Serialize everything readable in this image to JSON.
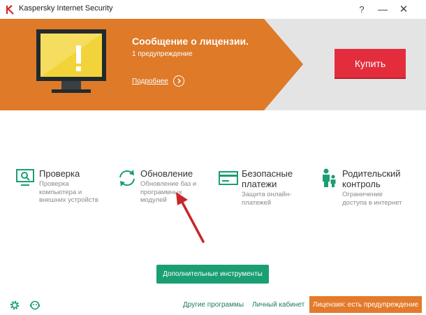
{
  "window": {
    "title": "Kaspersky Internet Security",
    "help_label": "?",
    "minimize_label": "—",
    "close_label": "✕"
  },
  "banner": {
    "title": "Сообщение о лицензии.",
    "subtitle": "1 предупреждение",
    "details_link": "Подробнее",
    "buy_label": "Купить",
    "colors": {
      "orange": "#de7a28",
      "gray": "#e4e4e4",
      "buy": "#e32d3d"
    }
  },
  "tiles": [
    {
      "icon": "scan-monitor-icon",
      "title_lines": [
        "Проверка"
      ],
      "desc_lines": [
        "Проверка",
        "компьютера и",
        "внешних устройств"
      ]
    },
    {
      "icon": "update-arrows-icon",
      "title_lines": [
        "Обновление"
      ],
      "desc_lines": [
        "Обновление баз и",
        "программных",
        "модулей"
      ]
    },
    {
      "icon": "credit-card-icon",
      "title_lines": [
        "Безопасные",
        "платежи"
      ],
      "desc_lines": [
        "Защита онлайн-",
        "платежей"
      ]
    },
    {
      "icon": "parental-control-icon",
      "title_lines": [
        "Родительский",
        "контроль"
      ],
      "desc_lines": [
        "Ограничение",
        "доступа в интернет"
      ]
    }
  ],
  "tools_button": "Дополнительные инструменты",
  "footer": {
    "settings_icon": "gear-icon",
    "support_icon": "support-icon",
    "other_programs": "Другие программы",
    "my_account": "Личный кабинет",
    "license_button": "Лицензия: есть предупреждение"
  },
  "accent_color": "#1a9e73"
}
